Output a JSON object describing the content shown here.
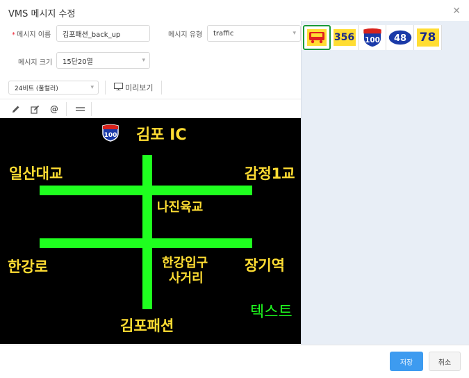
{
  "dialog": {
    "title": "VMS 메시지 수정",
    "close_icon": "close-icon"
  },
  "form": {
    "message_name_label": "메시지 이름",
    "required_mark": "*",
    "message_name_value": "김포패션_back_up",
    "message_type_label": "메시지 유형",
    "message_type_value": "traffic",
    "message_size_label": "메시지 크기",
    "message_size_value": "15단20열",
    "color_mode_value": "24비트 (풀컬러)",
    "preview_label": "미리보기"
  },
  "tools": [
    "pencil-icon",
    "edit-icon",
    "at-icon",
    "line-icon"
  ],
  "canvas": {
    "background": "#000000",
    "text_color": "#ffdd33",
    "bar_color": "#1fff1f",
    "route_shield_number": "100",
    "labels": {
      "top": "김포 IC",
      "left_upper": "일산대교",
      "right_upper": "감정1교",
      "center_upper": "나진육교",
      "left_lower": "한강로",
      "center_lower_1": "한강입구",
      "center_lower_2": "사거리",
      "right_lower": "장기역",
      "bottom": "김포패션",
      "sample_text": "텍스트"
    }
  },
  "symbol_palette": {
    "items": [
      {
        "name": "car-icon",
        "selected": true
      },
      {
        "name": "route-356-icon",
        "text": "356"
      },
      {
        "name": "route-100-shield-icon",
        "text": "100"
      },
      {
        "name": "route-48-oval-icon",
        "text": "48"
      },
      {
        "name": "route-78-icon",
        "text": "78"
      }
    ]
  },
  "footer": {
    "save_label": "저장",
    "cancel_label": "취소"
  }
}
